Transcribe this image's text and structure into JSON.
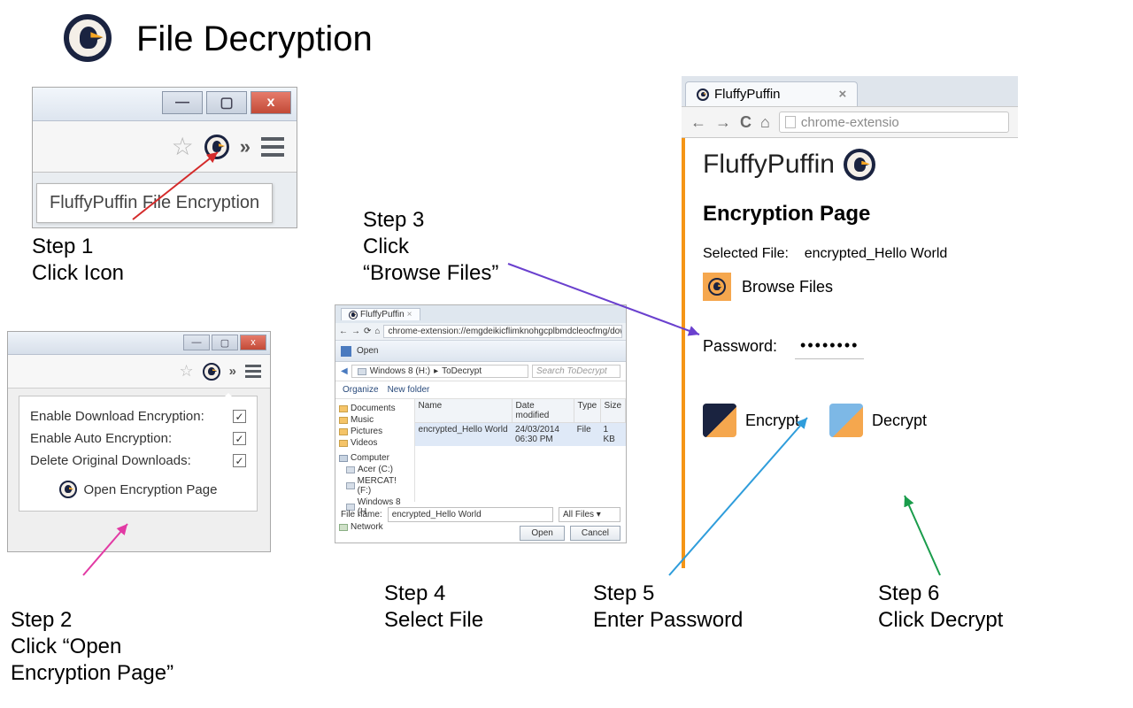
{
  "page_title": "File Decryption",
  "steps": {
    "s1": {
      "label": "Step 1",
      "text": "Click Icon"
    },
    "s2": {
      "label": "Step 2",
      "text": "Click “Open\nEncryption Page”"
    },
    "s3": {
      "label": "Step 3",
      "text": "Click\n“Browse Files”"
    },
    "s4": {
      "label": "Step 4",
      "text": "Select File"
    },
    "s5": {
      "label": "Step 5",
      "text": "Enter Password"
    },
    "s6": {
      "label": "Step 6",
      "text": "Click Decrypt"
    }
  },
  "step1": {
    "tooltip": "FluffyPuffin File Encryption"
  },
  "step2": {
    "opt_download": "Enable Download Encryption:",
    "opt_auto": "Enable Auto Encryption:",
    "opt_delete": "Delete Original Downloads:",
    "open_button": "Open Encryption Page"
  },
  "step4": {
    "tab_title": "FluffyPuffin",
    "address": "chrome-extension://emgdeikicflimknohgcplbmdcleocfmg/downcrypt.ht",
    "dialog_title": "Open",
    "crumb1": "Windows 8 (H:)",
    "crumb2": "ToDecrypt",
    "search_placeholder": "Search ToDecrypt",
    "cmd_organize": "Organize",
    "cmd_newfolder": "New folder",
    "tree": {
      "documents": "Documents",
      "music": "Music",
      "pictures": "Pictures",
      "videos": "Videos",
      "computer": "Computer",
      "acer": "Acer (C:)",
      "mercat": "MERCAT! (F:)",
      "win8": "Windows 8 (H",
      "network": "Network"
    },
    "headers": {
      "name": "Name",
      "date": "Date modified",
      "type": "Type",
      "size": "Size"
    },
    "row": {
      "name": "encrypted_Hello World",
      "date": "24/03/2014 06:30 PM",
      "type": "File",
      "size": "1 KB"
    },
    "filename_label": "File name:",
    "filename_value": "encrypted_Hello World",
    "filter": "All Files",
    "open_btn": "Open",
    "cancel_btn": "Cancel"
  },
  "mainPage": {
    "tab_title": "FluffyPuffin",
    "url_text": "chrome-extensio",
    "brand": "FluffyPuffin",
    "heading": "Encryption Page",
    "selected_label": "Selected File:",
    "selected_value": "encrypted_Hello World",
    "browse": "Browse Files",
    "password_label": "Password:",
    "password_value": "••••••••",
    "encrypt": "Encrypt",
    "decrypt": "Decrypt"
  }
}
